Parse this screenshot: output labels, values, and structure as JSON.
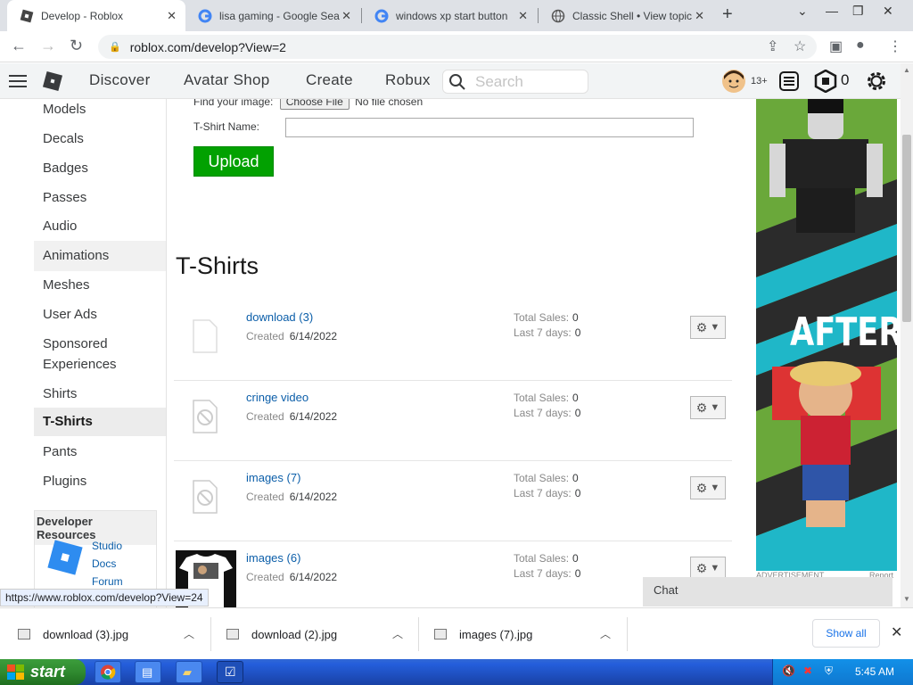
{
  "browser": {
    "tabs": [
      {
        "title": "Develop - Roblox",
        "active": true
      },
      {
        "title": "lisa gaming - Google Sea"
      },
      {
        "title": "windows xp start button"
      },
      {
        "title": "Classic Shell • View topic"
      }
    ],
    "url": "roblox.com/develop?View=2"
  },
  "header": {
    "nav": [
      "Discover",
      "Avatar Shop",
      "Create",
      "Robux"
    ],
    "search_placeholder": "Search",
    "age_badge": "13+",
    "robux_count": "0"
  },
  "sidebar": {
    "items": [
      "Models",
      "Decals",
      "Badges",
      "Passes",
      "Audio",
      "Animations",
      "Meshes",
      "User Ads",
      "Sponsored Experiences",
      "Shirts",
      "T-Shirts",
      "Pants",
      "Plugins"
    ],
    "selected": "T-Shirts",
    "dev_resources": {
      "title": "Developer Resources",
      "links": [
        "Studio",
        "Docs",
        "Forum"
      ]
    }
  },
  "form": {
    "find_image_label": "Find your image:",
    "choose_file": "Choose File",
    "no_file": "No file chosen",
    "name_label": "T-Shirt Name:",
    "name_value": "",
    "upload_label": "Upload"
  },
  "section_title": "T-Shirts",
  "items": [
    {
      "name": "download (3)",
      "created_label": "Created",
      "created": "6/14/2022",
      "total_label": "Total Sales:",
      "total": "0",
      "week_label": "Last 7 days:",
      "week": "0"
    },
    {
      "name": "cringe video",
      "created_label": "Created",
      "created": "6/14/2022",
      "total_label": "Total Sales:",
      "total": "0",
      "week_label": "Last 7 days:",
      "week": "0"
    },
    {
      "name": "images (7)",
      "created_label": "Created",
      "created": "6/14/2022",
      "total_label": "Total Sales:",
      "total": "0",
      "week_label": "Last 7 days:",
      "week": "0"
    },
    {
      "name": "images (6)",
      "created_label": "Created",
      "created": "6/14/2022",
      "total_label": "Total Sales:",
      "total": "0",
      "week_label": "Last 7 days:",
      "week": "0"
    }
  ],
  "ad": {
    "text": "AFTER",
    "label": "ADVERTISEMENT",
    "report": "Report"
  },
  "status_url": "https://www.roblox.com/develop?View=24",
  "chat_label": "Chat",
  "downloads": {
    "files": [
      "download (3).jpg",
      "download (2).jpg",
      "images (7).jpg"
    ],
    "show_all": "Show all"
  },
  "taskbar": {
    "start_label": "start",
    "clock": "5:45 AM"
  }
}
